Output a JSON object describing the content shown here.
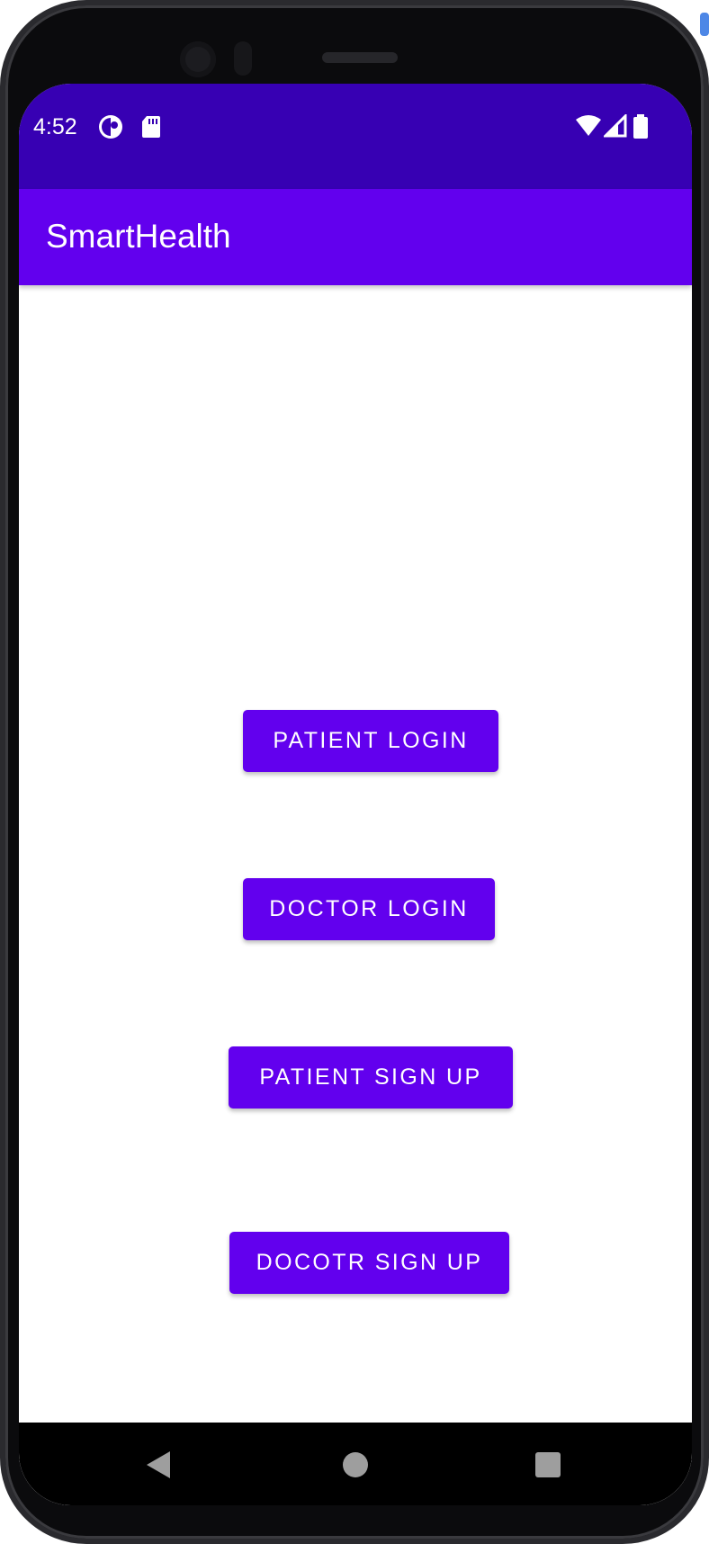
{
  "status_bar": {
    "time": "4:52",
    "left_icons": [
      "circle-half-icon",
      "sd-card-icon"
    ],
    "right_icons": [
      "wifi-icon",
      "cell-signal-icon",
      "battery-icon"
    ],
    "color": "#3700b3"
  },
  "app_bar": {
    "title": "SmartHealth",
    "color": "#6200ee"
  },
  "buttons": {
    "patient_login": "PATIENT LOGIN",
    "doctor_login": "DOCTOR LOGIN",
    "patient_signup": "PATIENT SIGN UP",
    "doctor_signup": "DOCOTR SIGN UP",
    "color": "#6200ee"
  },
  "nav_bar": {
    "icons": [
      "back-icon",
      "home-icon",
      "recents-icon"
    ]
  }
}
